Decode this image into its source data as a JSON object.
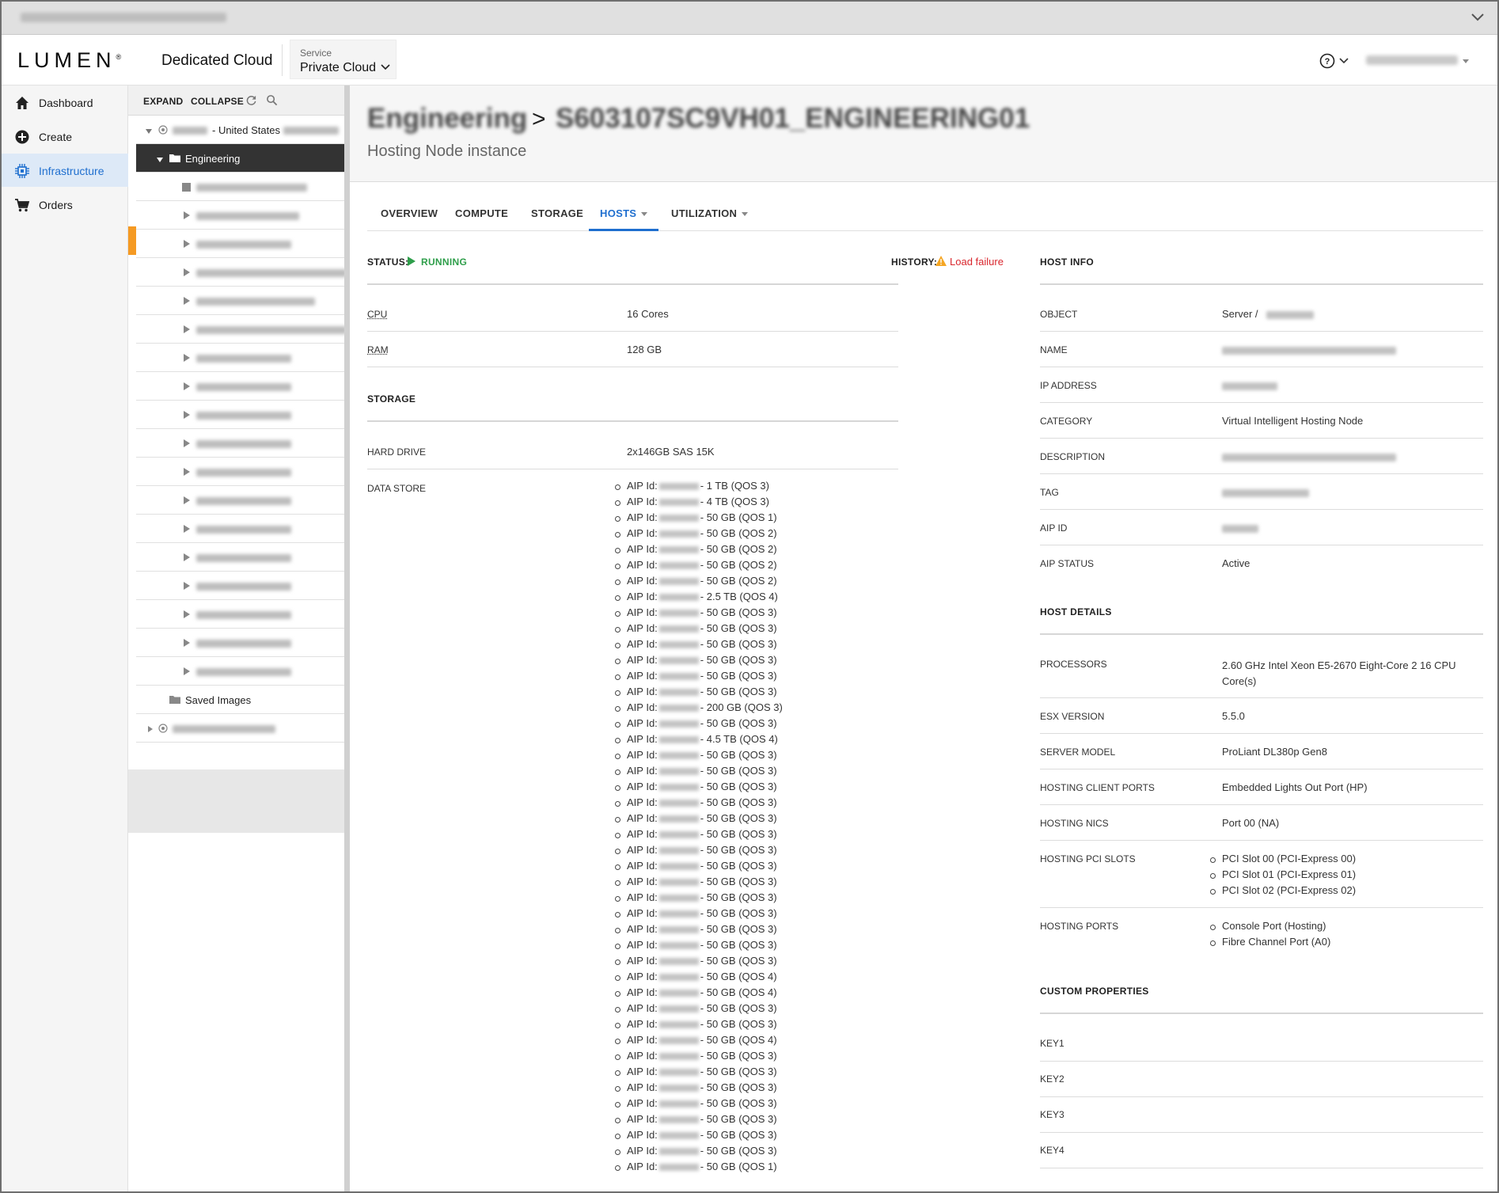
{
  "header": {
    "logo": "LUMEN",
    "product": "Dedicated Cloud",
    "service_label": "Service",
    "service_value": "Private Cloud"
  },
  "nav": {
    "items": [
      {
        "label": "Dashboard",
        "icon": "home-icon"
      },
      {
        "label": "Create",
        "icon": "plus-circle-icon"
      },
      {
        "label": "Infrastructure",
        "icon": "chip-icon"
      },
      {
        "label": "Orders",
        "icon": "cart-icon"
      }
    ],
    "active": "Infrastructure"
  },
  "tree": {
    "expand": "EXPAND",
    "collapse": "COLLAPSE",
    "location_suffix": "- United States",
    "selected_folder": "Engineering",
    "saved_images": "Saved Images"
  },
  "page": {
    "subtitle": "Hosting Node instance",
    "title_separator": ">"
  },
  "tabs": [
    {
      "label": "OVERVIEW"
    },
    {
      "label": "COMPUTE"
    },
    {
      "label": "STORAGE"
    },
    {
      "label": "HOSTS",
      "active": true
    },
    {
      "label": "UTILIZATION"
    }
  ],
  "status": {
    "label": "STATUS:",
    "value": "RUNNING",
    "history_label": "HISTORY:",
    "history_value": "Load failure",
    "running_color": "#2e9e4a",
    "error_color": "#d9262d"
  },
  "compute": {
    "cpu_label": "CPU",
    "cpu_value": "16 Cores",
    "ram_label": "RAM",
    "ram_value": "128 GB"
  },
  "storage": {
    "heading": "STORAGE",
    "hard_drive_label": "HARD DRIVE",
    "hard_drive_value": "2x146GB SAS 15K",
    "data_store_label": "DATA STORE",
    "aip_prefix": "AIP Id:",
    "data_store": [
      "- 1 TB (QOS 3)",
      "- 4 TB (QOS 3)",
      "- 50 GB (QOS 1)",
      "- 50 GB (QOS 2)",
      "- 50 GB (QOS 2)",
      "- 50 GB (QOS 2)",
      "- 50 GB (QOS 2)",
      "- 2.5 TB (QOS 4)",
      "- 50 GB (QOS 3)",
      "- 50 GB (QOS 3)",
      "- 50 GB (QOS 3)",
      "- 50 GB (QOS 3)",
      "- 50 GB (QOS 3)",
      "- 50 GB (QOS 3)",
      "- 200 GB (QOS 3)",
      "- 50 GB (QOS 3)",
      "- 4.5 TB (QOS 4)",
      "- 50 GB (QOS 3)",
      "- 50 GB (QOS 3)",
      "- 50 GB (QOS 3)",
      "- 50 GB (QOS 3)",
      "- 50 GB (QOS 3)",
      "- 50 GB (QOS 3)",
      "- 50 GB (QOS 3)",
      "- 50 GB (QOS 3)",
      "- 50 GB (QOS 3)",
      "- 50 GB (QOS 3)",
      "- 50 GB (QOS 3)",
      "- 50 GB (QOS 3)",
      "- 50 GB (QOS 3)",
      "- 50 GB (QOS 3)",
      "- 50 GB (QOS 4)",
      "- 50 GB (QOS 4)",
      "- 50 GB (QOS 3)",
      "- 50 GB (QOS 3)",
      "- 50 GB (QOS 4)",
      "- 50 GB (QOS 3)",
      "- 50 GB (QOS 3)",
      "- 50 GB (QOS 3)",
      "- 50 GB (QOS 3)",
      "- 50 GB (QOS 3)",
      "- 50 GB (QOS 3)",
      "- 50 GB (QOS 3)",
      "- 50 GB (QOS 1)"
    ]
  },
  "host_info": {
    "heading": "HOST INFO",
    "object_label": "OBJECT",
    "object_value": "Server /",
    "name_label": "NAME",
    "ip_label": "IP ADDRESS",
    "category_label": "CATEGORY",
    "category_value": "Virtual Intelligent Hosting Node",
    "description_label": "DESCRIPTION",
    "tag_label": "TAG",
    "aip_id_label": "AIP ID",
    "aip_status_label": "AIP STATUS",
    "aip_status_value": "Active"
  },
  "host_details": {
    "heading": "HOST DETAILS",
    "processors_label": "PROCESSORS",
    "processors_value": "2.60 GHz Intel Xeon E5-2670 Eight-Core 2 16 CPU Core(s)",
    "esx_label": "ESX VERSION",
    "esx_value": "5.5.0",
    "model_label": "SERVER MODEL",
    "model_value": "ProLiant DL380p Gen8",
    "client_ports_label": "HOSTING CLIENT PORTS",
    "client_ports_value": "Embedded Lights Out Port (HP)",
    "nics_label": "HOSTING NICS",
    "nics_value": "Port 00 (NA)",
    "pci_label": "HOSTING PCI SLOTS",
    "pci_slots": [
      "PCI Slot 00 (PCI-Express 00)",
      "PCI Slot 01 (PCI-Express 01)",
      "PCI Slot 02 (PCI-Express 02)"
    ],
    "ports_label": "HOSTING PORTS",
    "ports": [
      "Console Port (Hosting)",
      "Fibre Channel Port (A0)"
    ]
  },
  "custom_properties": {
    "heading": "CUSTOM PROPERTIES",
    "keys": [
      "KEY1",
      "KEY2",
      "KEY3",
      "KEY4"
    ]
  }
}
